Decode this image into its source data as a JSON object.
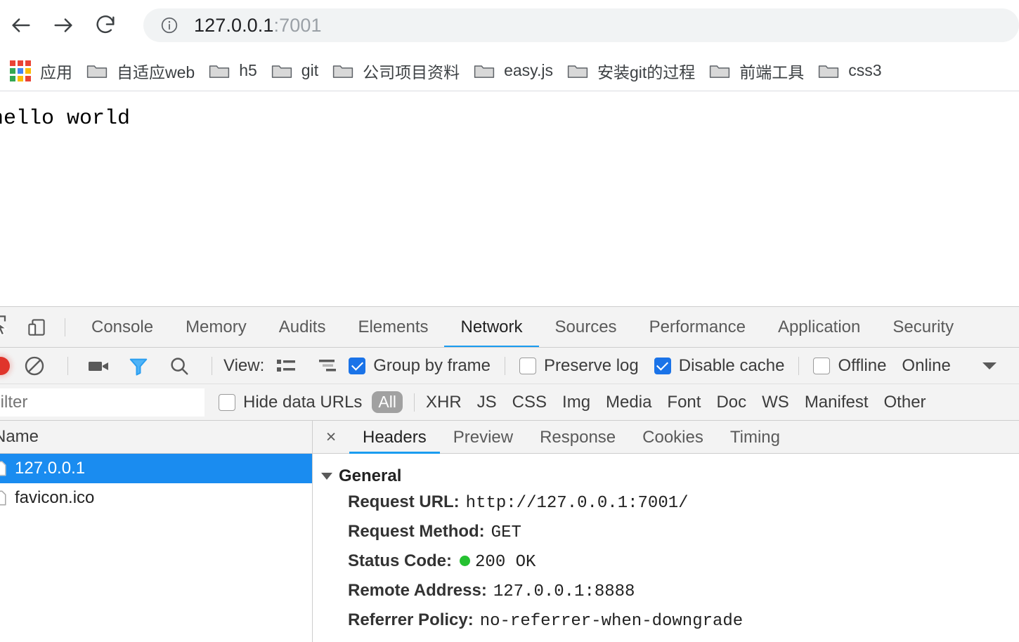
{
  "browser": {
    "back_label": "back-arrow",
    "forward_label": "forward-arrow",
    "reload_label": "reload",
    "omnibox": {
      "security_icon": "info-icon",
      "host": "127.0.0.1",
      "port": ":7001",
      "full_url": "127.0.0.1:7001"
    },
    "bookmarks": [
      {
        "label": "应用",
        "icon": "apps-grid-icon"
      },
      {
        "label": "自适应web",
        "icon": "folder-icon"
      },
      {
        "label": "h5",
        "icon": "folder-icon"
      },
      {
        "label": "git",
        "icon": "folder-icon"
      },
      {
        "label": "公司项目资料",
        "icon": "folder-icon"
      },
      {
        "label": "easy.js",
        "icon": "folder-icon"
      },
      {
        "label": "安装git的过程",
        "icon": "folder-icon"
      },
      {
        "label": "前端工具",
        "icon": "folder-icon"
      },
      {
        "label": "css3",
        "icon": "folder-icon"
      }
    ]
  },
  "page": {
    "body_text": "hello world"
  },
  "devtools": {
    "tabs": [
      {
        "label": "Console",
        "active": false
      },
      {
        "label": "Memory",
        "active": false
      },
      {
        "label": "Audits",
        "active": false
      },
      {
        "label": "Elements",
        "active": false
      },
      {
        "label": "Network",
        "active": true
      },
      {
        "label": "Sources",
        "active": false
      },
      {
        "label": "Performance",
        "active": false
      },
      {
        "label": "Application",
        "active": false
      },
      {
        "label": "Security",
        "active": false
      }
    ],
    "toolbar": {
      "record_icon": "record-button-active",
      "clear_icon": "clear-icon",
      "capture_screenshots_icon": "camera-icon",
      "filter_icon": "filter-funnel-icon",
      "search_icon": "search-icon",
      "view_label": "View:",
      "view_list_icon": "list-view-icon",
      "view_waterfall_icon": "waterfall-view-icon",
      "group_by_frame": {
        "label": "Group by frame",
        "checked": true
      },
      "preserve_log": {
        "label": "Preserve log",
        "checked": false
      },
      "disable_cache": {
        "label": "Disable cache",
        "checked": true
      },
      "offline": {
        "label": "Offline",
        "checked": false
      },
      "throttling": {
        "label": "Online",
        "chevron": "chevron-down-icon"
      }
    },
    "filter_bar": {
      "filter_placeholder": "Filter",
      "filter_value": "",
      "hide_data_urls": {
        "label": "Hide data URLs",
        "checked": false
      },
      "all_badge": "All",
      "types": [
        "XHR",
        "JS",
        "CSS",
        "Img",
        "Media",
        "Font",
        "Doc",
        "WS",
        "Manifest",
        "Other"
      ]
    },
    "requests": {
      "column_header": "Name",
      "rows": [
        {
          "name": "127.0.0.1",
          "selected": true,
          "icon": "document-file-icon"
        },
        {
          "name": "favicon.ico",
          "selected": false,
          "icon": "document-file-icon"
        }
      ]
    },
    "details": {
      "close_label": "×",
      "tabs": [
        {
          "label": "Headers",
          "active": true
        },
        {
          "label": "Preview",
          "active": false
        },
        {
          "label": "Response",
          "active": false
        },
        {
          "label": "Cookies",
          "active": false
        },
        {
          "label": "Timing",
          "active": false
        }
      ],
      "general_title": "General",
      "general": [
        {
          "key": "Request URL:",
          "value": "http://127.0.0.1:7001/"
        },
        {
          "key": "Request Method:",
          "value": "GET"
        },
        {
          "key": "Status Code:",
          "value": "200 OK",
          "status_dot": "#25c131"
        },
        {
          "key": "Remote Address:",
          "value": "127.0.0.1:8888"
        },
        {
          "key": "Referrer Policy:",
          "value": "no-referrer-when-downgrade"
        }
      ]
    }
  },
  "colors": {
    "accent_blue": "#1a9cf0",
    "selection_blue": "#1a8cf0",
    "checkbox_blue": "#1a73e8",
    "status_green": "#25c131",
    "record_red": "#e0342b",
    "toolbar_grey": "#f3f3f3"
  }
}
